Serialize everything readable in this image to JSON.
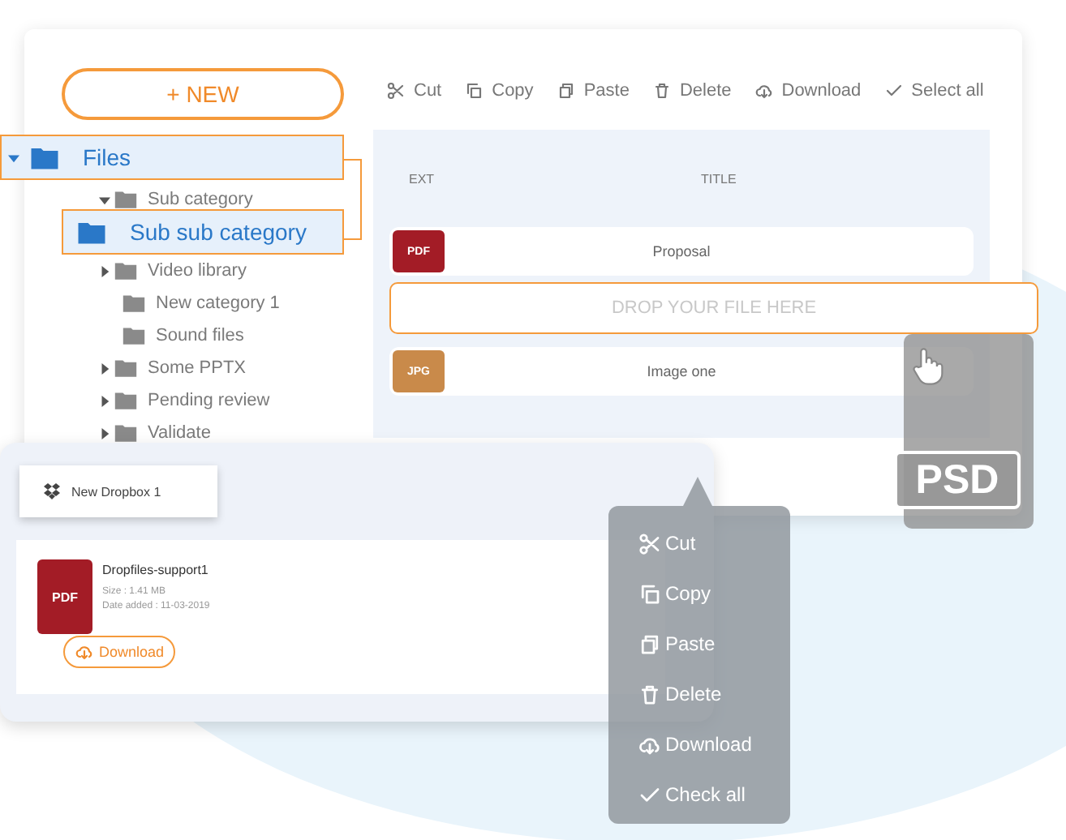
{
  "new_button": {
    "label": "+ NEW"
  },
  "tree": [
    {
      "label": "Files",
      "selected": true,
      "expanded": true,
      "children": [
        {
          "label": "Sub category",
          "selected": false,
          "expanded": true,
          "children": [
            {
              "label": "Sub sub category",
              "selected": true
            }
          ]
        },
        {
          "label": "Video library",
          "selected": false,
          "expanded": false,
          "has_children": true
        },
        {
          "label": "New category 1",
          "selected": false
        },
        {
          "label": "Sound files",
          "selected": false
        },
        {
          "label": "Some PPTX",
          "selected": false,
          "expanded": false,
          "has_children": true
        },
        {
          "label": "Pending review",
          "selected": false,
          "expanded": false,
          "has_children": true
        },
        {
          "label": "Validate",
          "selected": false,
          "expanded": false,
          "has_children": true
        }
      ]
    }
  ],
  "toolbar": [
    {
      "label": "Cut",
      "kind": "cut"
    },
    {
      "label": "Copy",
      "kind": "copy"
    },
    {
      "label": "Paste",
      "kind": "paste"
    },
    {
      "label": "Delete",
      "kind": "delete"
    },
    {
      "label": "Download",
      "kind": "download"
    },
    {
      "label": "Select all",
      "kind": "check"
    }
  ],
  "table": {
    "columns": [
      "EXT",
      "TITLE"
    ],
    "rows": [
      {
        "kind": "file",
        "ext": "PDF",
        "color": "#a31c26",
        "title": "Proposal"
      },
      {
        "kind": "dropzone",
        "text": "DROP YOUR FILE HERE"
      },
      {
        "kind": "file",
        "ext": "JPG",
        "color": "#c98a4a",
        "title": "Image one"
      }
    ]
  },
  "dropbox_card": {
    "tab": "New Dropbox 1",
    "file": {
      "ext": "PDF",
      "color": "#a31c26",
      "name": "Dropfiles-support1",
      "size": "Size : 1.41 MB",
      "date": "Date added : 11-03-2019",
      "button": "Download"
    }
  },
  "context_menu": [
    {
      "label": "Cut",
      "kind": "cut"
    },
    {
      "label": "Copy",
      "kind": "copy"
    },
    {
      "label": "Paste",
      "kind": "paste"
    },
    {
      "label": "Delete",
      "kind": "delete"
    },
    {
      "label": "Download",
      "kind": "download"
    },
    {
      "label": "Check all",
      "kind": "check"
    }
  ],
  "dragged_file": {
    "ext": "PSD"
  }
}
